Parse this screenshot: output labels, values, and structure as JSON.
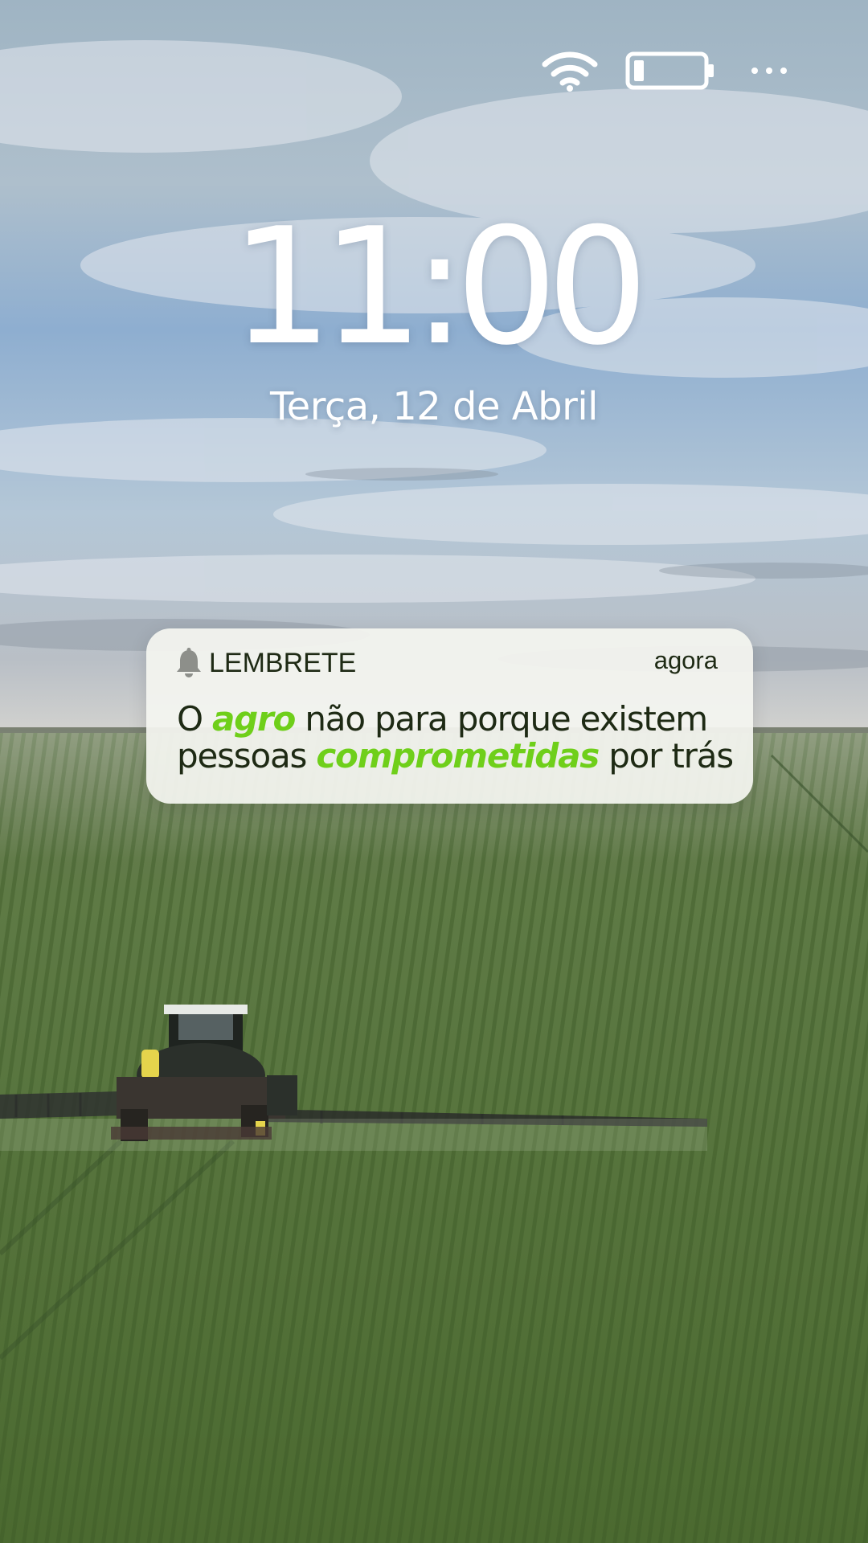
{
  "status_bar": {
    "wifi": "wifi-icon",
    "battery": "battery-icon",
    "more": "more-icon"
  },
  "lock_screen": {
    "time": "11:00",
    "date": "Terça, 12 de Abril"
  },
  "notification": {
    "app_icon": "bell-icon",
    "app_name": "LEMBRETE",
    "time": "agora",
    "body": {
      "line1_prefix": "O",
      "line1_highlight": "agro",
      "line1_suffix": "não para porque existem",
      "line2_prefix": "pessoas",
      "line2_highlight": "comprometidas",
      "line2_suffix": "por trás"
    },
    "highlight_color": "#6fcf1a",
    "text_color": "#1e2a14"
  }
}
